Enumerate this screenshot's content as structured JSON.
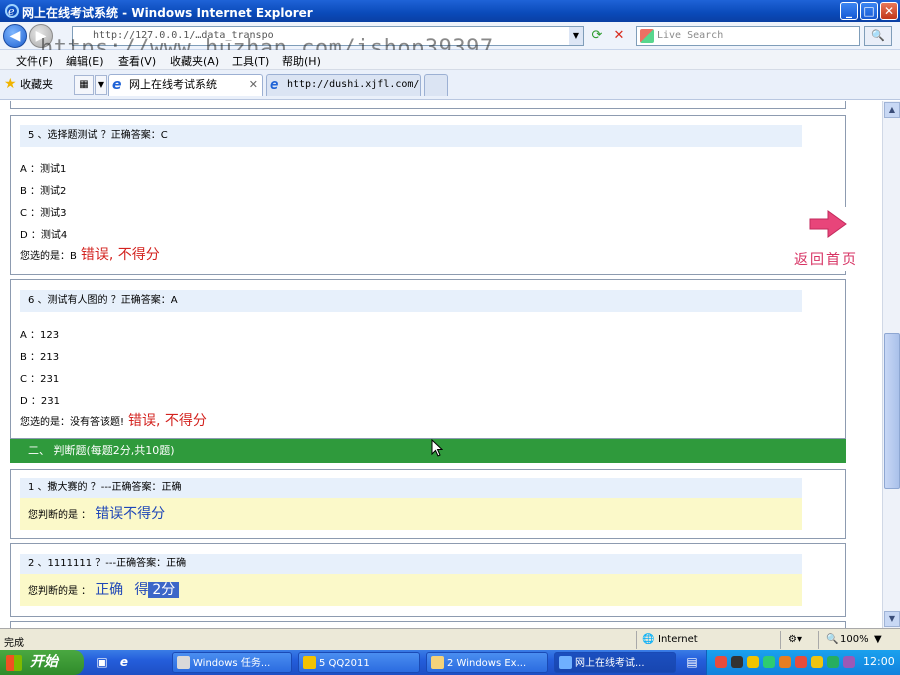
{
  "window": {
    "title": "网上在线考试系统 - Windows Internet Explorer",
    "min_glyph": "_",
    "max_glyph": "□",
    "close_glyph": "✕"
  },
  "address_bar": {
    "url": "http://127.0.0.1/…data_transpo",
    "watermark": "https://www.huzhan.com/ishop39397",
    "search_placeholder": "Live Search"
  },
  "menu": [
    "文件(F)",
    "编辑(E)",
    "查看(V)",
    "收藏夹(A)",
    "工具(T)",
    "帮助(H)"
  ],
  "favorites_label": "收藏夹",
  "tabs": [
    {
      "label": "网上在线考试系统",
      "active": true
    },
    {
      "label": "http://dushi.xjfl.com/...",
      "active": false
    }
  ],
  "questions": [
    {
      "header": "5 、选择题测试 ？正确答案：C",
      "options": [
        "A ：测试1",
        "B ：测试2",
        "C ：测试3",
        "D ：测试4"
      ],
      "answer_prefix": "您选的是：B",
      "verdict": "错误, 不得分"
    },
    {
      "header": "6 、测试有人图的 ？正确答案：A",
      "options": [
        "A ：123",
        "B ：213",
        "C ：231",
        "D ：231"
      ],
      "answer_prefix": "您选的是：没有答该题!",
      "verdict": "错误, 不得分"
    }
  ],
  "section2_title": "二、  判断题(每题2分,共10题)",
  "judgements": [
    {
      "header": "1 、撒大赛的 ？---正确答案：正确",
      "answer_prefix": "您判断的是 ：",
      "verdict": "错误不得分"
    },
    {
      "header": "2 、1111111 ？---正确答案：正确",
      "answer_prefix": "您判断的是 ：",
      "verdict": "正确",
      "score_prefix": "得",
      "score_value": "2分"
    }
  ],
  "back_home_label": "返回首页",
  "status": {
    "left": "完成",
    "zone": "Internet",
    "zoom": "100%"
  },
  "taskbar": {
    "start_label": "开始",
    "tasks": [
      "Windows 任务...",
      "5 QQ2011",
      "2 Windows Ex...",
      "网上在线考试..."
    ],
    "clock": "12:00"
  },
  "colors": {
    "section_green": "#2f9a3c",
    "verdict_red": "#d3231f",
    "verdict_blue": "#1f47b8",
    "answer_yellow": "#fbf9c9",
    "header_blue": "#e7f0fb"
  }
}
